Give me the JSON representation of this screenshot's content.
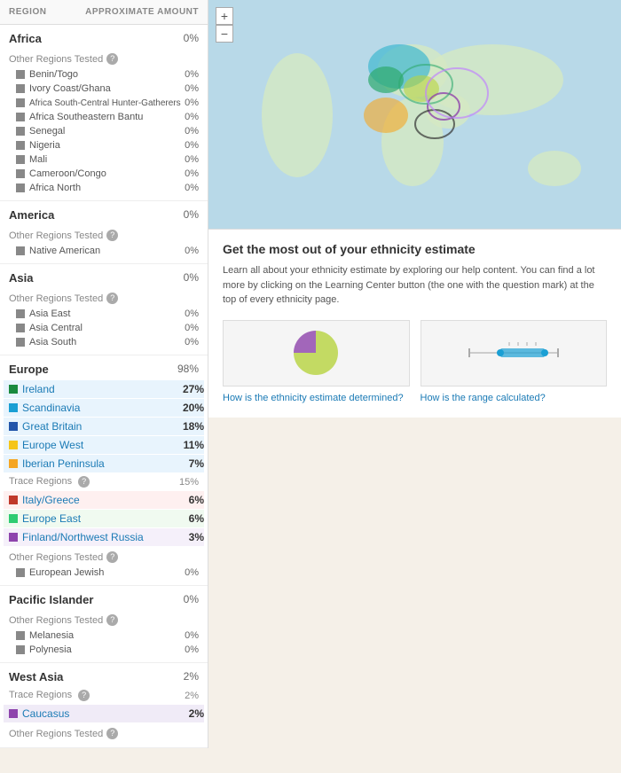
{
  "header": {
    "region_label": "REGION",
    "amount_label": "APPROXIMATE AMOUNT"
  },
  "regions": [
    {
      "name": "Africa",
      "pct": "0%",
      "other_regions": true,
      "items": [
        {
          "label": "Benin/Togo",
          "pct": "0%",
          "color": "#888"
        },
        {
          "label": "Ivory Coast/Ghana",
          "pct": "0%",
          "color": "#888"
        },
        {
          "label": "Africa South-Central Hunter-Gatherers",
          "pct": "0%",
          "color": "#888"
        },
        {
          "label": "Africa Southeastern Bantu",
          "pct": "0%",
          "color": "#888"
        },
        {
          "label": "Senegal",
          "pct": "0%",
          "color": "#888"
        },
        {
          "label": "Nigeria",
          "pct": "0%",
          "color": "#888"
        },
        {
          "label": "Mali",
          "pct": "0%",
          "color": "#888"
        },
        {
          "label": "Cameroon/Congo",
          "pct": "0%",
          "color": "#888"
        },
        {
          "label": "Africa North",
          "pct": "0%",
          "color": "#888"
        }
      ]
    },
    {
      "name": "America",
      "pct": "0%",
      "other_regions": true,
      "items": [
        {
          "label": "Native American",
          "pct": "0%",
          "color": "#888"
        }
      ]
    },
    {
      "name": "Asia",
      "pct": "0%",
      "other_regions": true,
      "items": [
        {
          "label": "Asia East",
          "pct": "0%",
          "color": "#888"
        },
        {
          "label": "Asia Central",
          "pct": "0%",
          "color": "#888"
        },
        {
          "label": "Asia South",
          "pct": "0%",
          "color": "#888"
        }
      ]
    },
    {
      "name": "Europe",
      "pct": "98%",
      "other_regions": true,
      "highlighted": [
        {
          "label": "Ireland",
          "pct": "27%",
          "color": "#1a8a3e"
        },
        {
          "label": "Scandinavia",
          "pct": "20%",
          "color": "#1a9fd4"
        },
        {
          "label": "Great Britain",
          "pct": "18%",
          "color": "#2255aa"
        },
        {
          "label": "Europe West",
          "pct": "11%",
          "color": "#f5c518"
        },
        {
          "label": "Iberian Peninsula",
          "pct": "7%",
          "color": "#f5a623"
        }
      ],
      "trace_label": "Trace Regions",
      "trace_pct": "15%",
      "trace_items": [
        {
          "label": "Italy/Greece",
          "pct": "6%",
          "color": "#c0392b"
        },
        {
          "label": "Europe East",
          "pct": "6%",
          "color": "#2ecc71"
        },
        {
          "label": "Finland/Northwest Russia",
          "pct": "3%",
          "color": "#8e44ad"
        }
      ],
      "items": [
        {
          "label": "European Jewish",
          "pct": "0%",
          "color": "#888"
        }
      ]
    },
    {
      "name": "Pacific Islander",
      "pct": "0%",
      "other_regions": true,
      "items": [
        {
          "label": "Melanesia",
          "pct": "0%",
          "color": "#888"
        },
        {
          "label": "Polynesia",
          "pct": "0%",
          "color": "#888"
        }
      ]
    },
    {
      "name": "West Asia",
      "pct": "2%",
      "other_regions": false,
      "trace_label": "Trace Regions",
      "trace_pct": "2%",
      "caucasus": {
        "label": "Caucasus",
        "pct": "2%",
        "color": "#8e44ad"
      },
      "other_regions_after": true
    }
  ],
  "map": {
    "zoom_in": "+",
    "zoom_out": "−"
  },
  "info": {
    "title": "Get the most out of your ethnicity estimate",
    "text": "Learn all about your ethnicity estimate by exploring our help content. You can find a lot more by clicking on the Learning Center button (the one with the question mark) at the top of every ethnicity page.",
    "card1_link": "How is the ethnicity estimate determined?",
    "card2_link": "How is the range calculated?"
  }
}
